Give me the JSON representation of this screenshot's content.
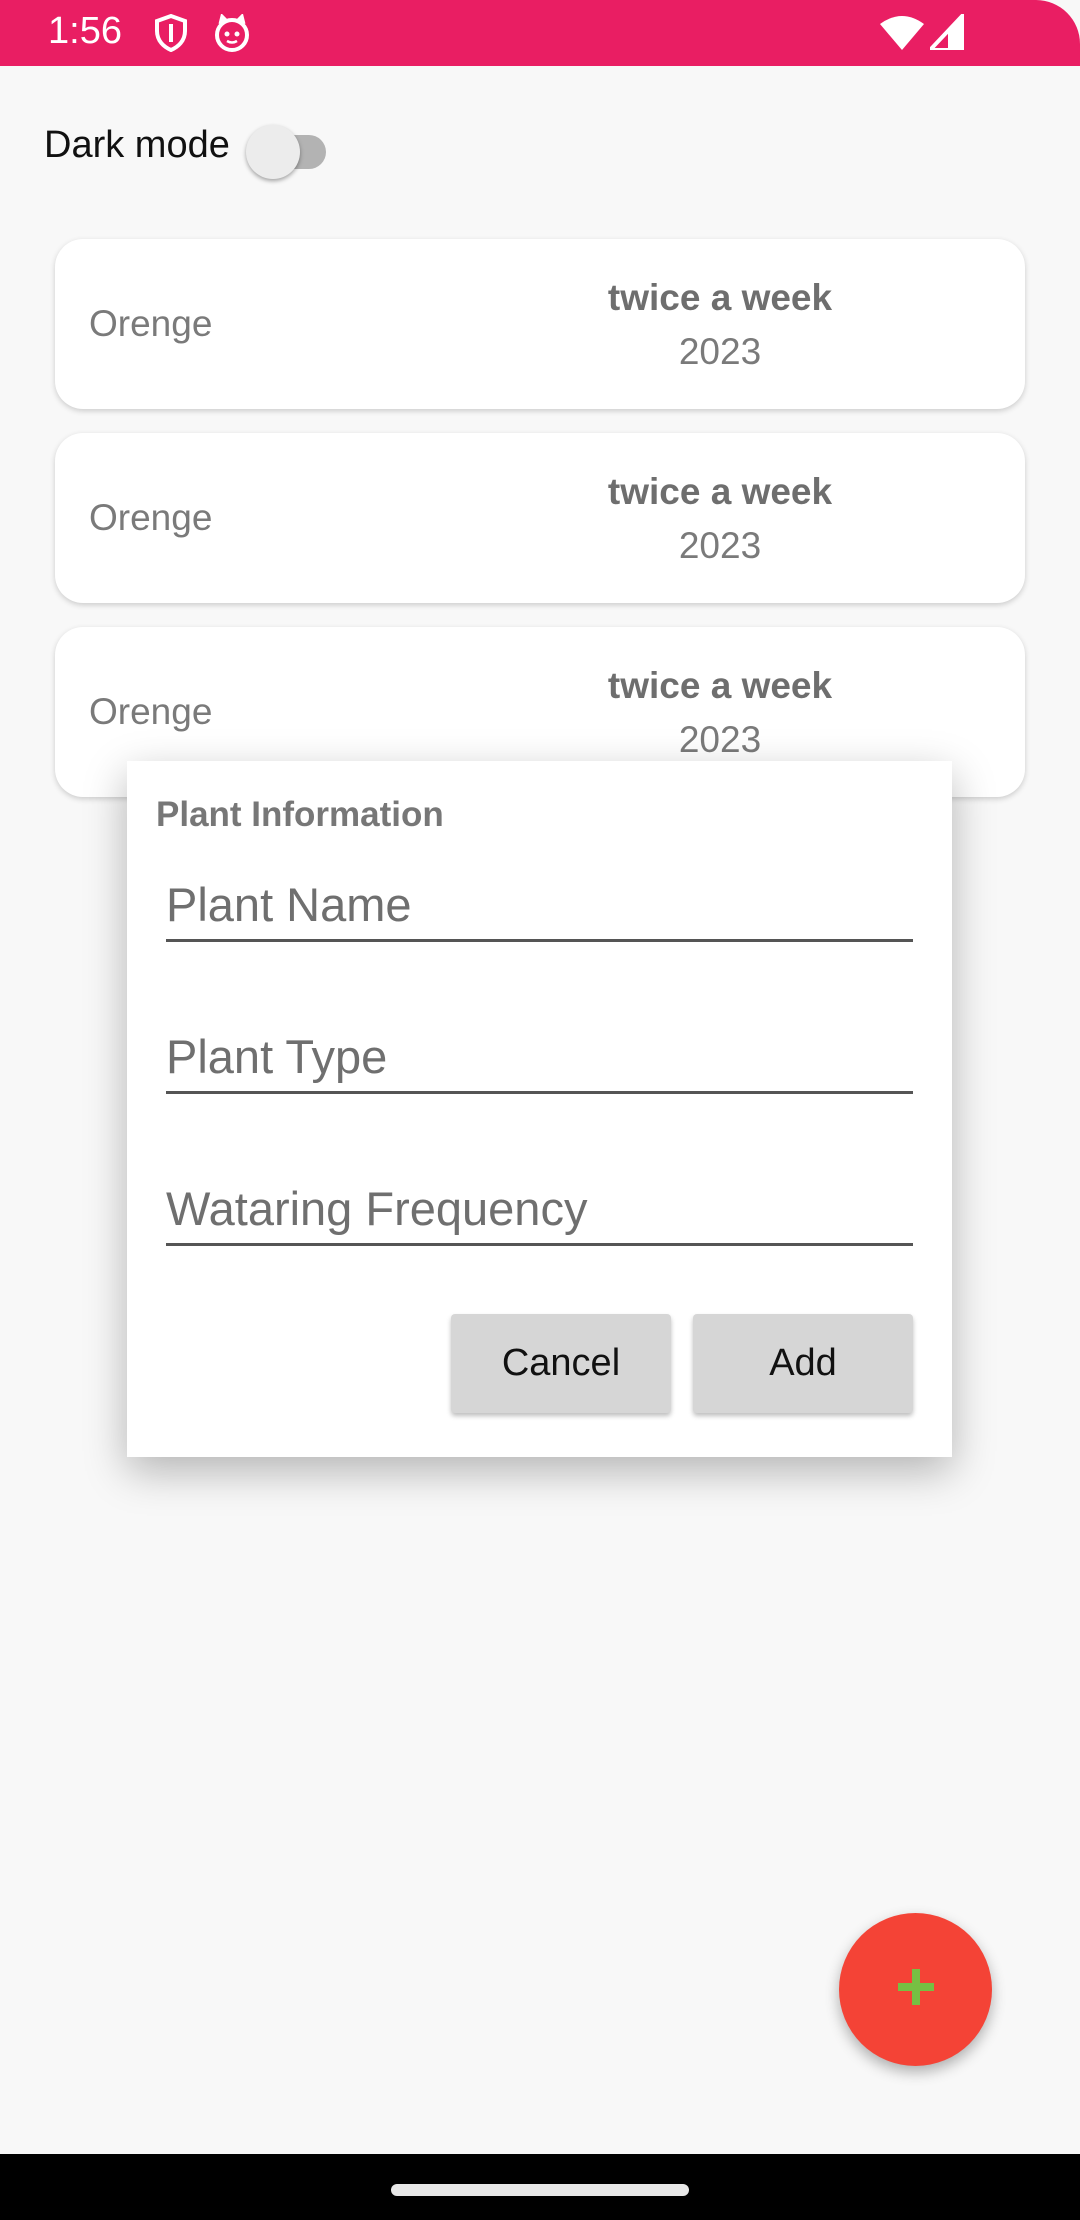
{
  "status_bar": {
    "time": "1:56",
    "background_color": "#e91e63",
    "icons": [
      "shield-icon",
      "cat-notification-icon",
      "wifi-icon",
      "cell-signal-icon"
    ]
  },
  "settings": {
    "dark_mode_label": "Dark mode",
    "dark_mode_on": false
  },
  "plants": [
    {
      "name": "Orenge",
      "frequency": "twice a week",
      "year": "2023"
    },
    {
      "name": "Orenge",
      "frequency": "twice a week",
      "year": "2023"
    },
    {
      "name": "Orenge",
      "frequency": "twice a week",
      "year": "2023"
    }
  ],
  "dialog": {
    "title": "Plant Information",
    "fields": {
      "plant_name": {
        "value": "",
        "placeholder": "Plant Name"
      },
      "plant_type": {
        "value": "",
        "placeholder": "Plant Type"
      },
      "watering_frequency": {
        "value": "",
        "placeholder": "Wataring Frequency"
      }
    },
    "cancel_label": "Cancel",
    "add_label": "Add"
  },
  "fab": {
    "icon": "plus-icon",
    "background_color": "#f44336",
    "icon_color": "#76c043"
  }
}
